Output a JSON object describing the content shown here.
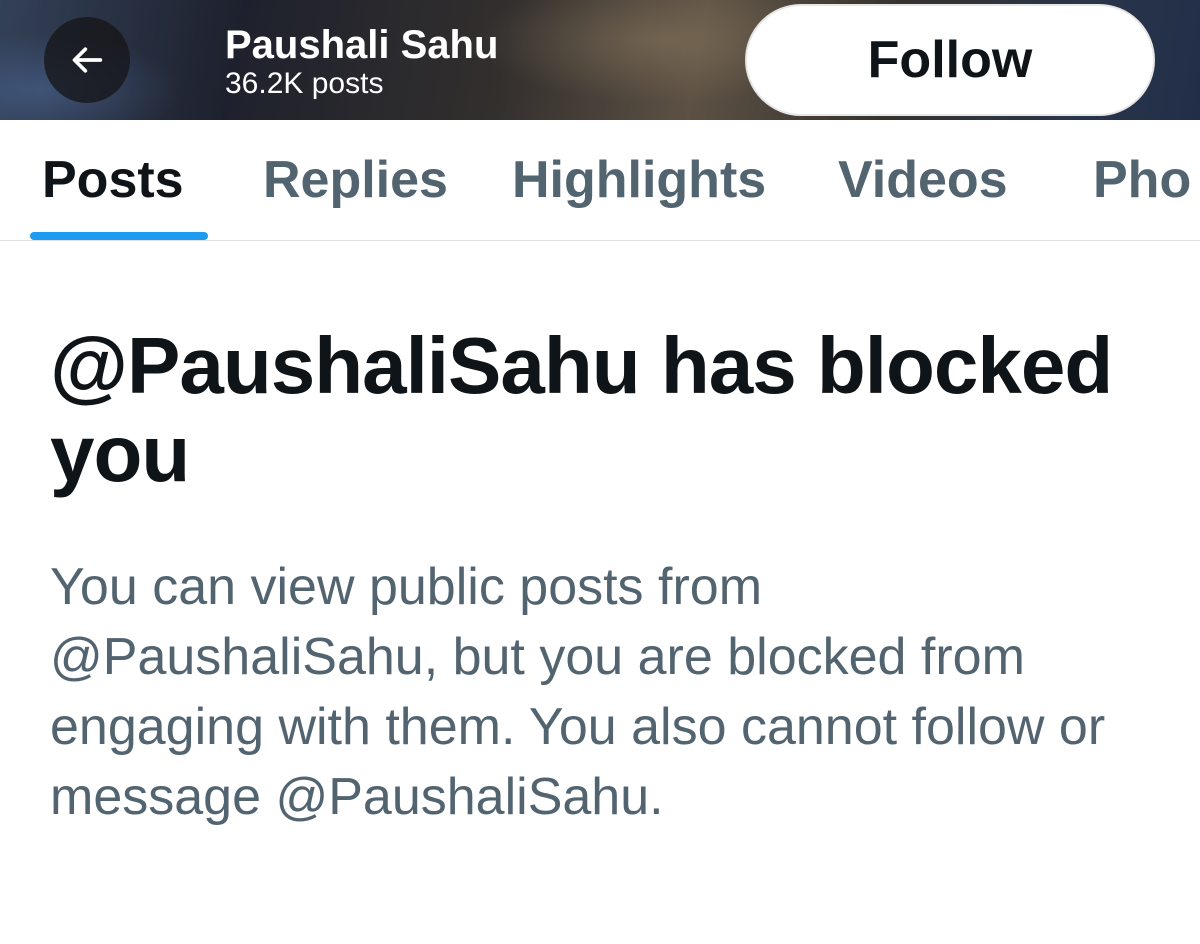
{
  "header": {
    "back_icon": "arrow-left-icon",
    "name": "Paushali Sahu",
    "post_count": "36.2K posts",
    "follow_label": "Follow"
  },
  "tabs": [
    {
      "label": "Posts",
      "active": true
    },
    {
      "label": "Replies",
      "active": false
    },
    {
      "label": "Highlights",
      "active": false
    },
    {
      "label": "Videos",
      "active": false
    },
    {
      "label": "Pho",
      "active": false
    }
  ],
  "blocked": {
    "title": "@PaushaliSahu has blocked you",
    "description": "You can view public posts from @PaushaliSahu, but you are blocked from engaging with them. You also cannot follow or message @PaushaliSahu."
  },
  "colors": {
    "accent": "#1d9bf0",
    "primary_text": "#0f1419",
    "secondary_text": "#536471"
  }
}
